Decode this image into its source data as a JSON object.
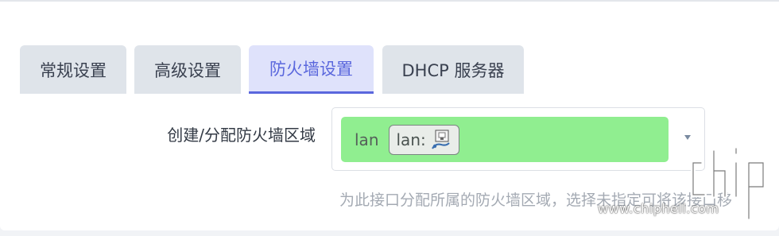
{
  "tabs": [
    {
      "label": "常规设置",
      "active": false
    },
    {
      "label": "高级设置",
      "active": false
    },
    {
      "label": "防火墙设置",
      "active": true
    },
    {
      "label": "DHCP 服务器",
      "active": false
    }
  ],
  "firewall": {
    "field_label": "创建/分配防火墙区域",
    "selected_zone": "lan",
    "interface_badge": "lan:",
    "interface_icon": "network-port-icon",
    "zone_color": "#90ee90",
    "help_text": "为此接口分配所属的防火墙区域，选择未指定可将该接口移"
  },
  "watermark": {
    "logo_text": "chip",
    "url": "www.chiphell.com"
  },
  "colors": {
    "accent": "#5a67dd",
    "active_tab_bg": "#dfe2fb",
    "tab_bg": "#dfe4ea"
  }
}
